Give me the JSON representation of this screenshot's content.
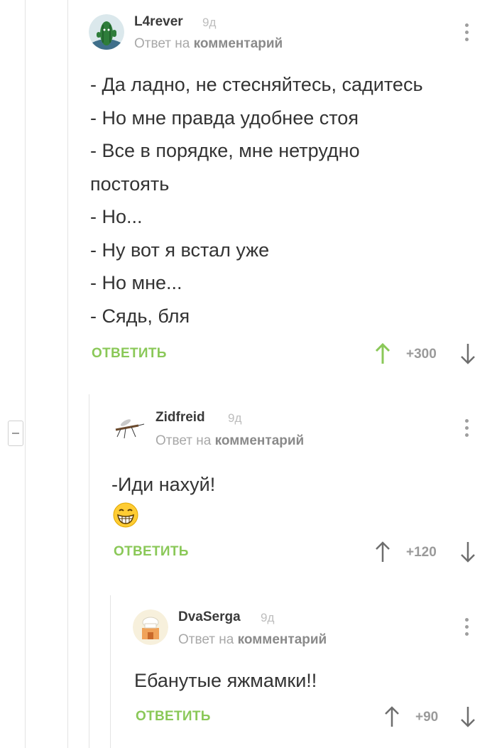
{
  "comments": [
    {
      "username": "L4rever",
      "age": "9д",
      "reply_prefix": "Ответ на",
      "reply_target": "комментарий",
      "lines": [
        "- Да ладно, не стесняйтесь, садитесь",
        "- Но мне правда удобнее стоя",
        "- Все в порядке, мне нетрудно",
        "постоять",
        "- Но...",
        "- Ну вот я встал уже",
        "- Но мне...",
        "- Сядь, бля"
      ],
      "reply_label": "ОТВЕТИТЬ",
      "rating": "+300",
      "avatar": "cactus-avatar"
    },
    {
      "username": "Zidfreid",
      "age": "9д",
      "reply_prefix": "Ответ на",
      "reply_target": "комментарий",
      "lines": [
        "-Иди нахуй!"
      ],
      "emoji": "grinning-emoji",
      "reply_label": "ОТВЕТИТЬ",
      "rating": "+120",
      "avatar": "mosquito-avatar"
    },
    {
      "username": "DvaSerga",
      "age": "9д",
      "reply_prefix": "Ответ на",
      "reply_target": "комментарий",
      "lines": [
        "Ебанутые яжмамки!!"
      ],
      "reply_label": "ОТВЕТИТЬ",
      "rating": "+90",
      "avatar": "chef-house-avatar"
    }
  ],
  "colors": {
    "accent_green": "#8ac858",
    "upvote_active": "#8ac858",
    "text": "#333333",
    "muted": "#a8a8a8",
    "thread_line": "#e3e3e3"
  }
}
